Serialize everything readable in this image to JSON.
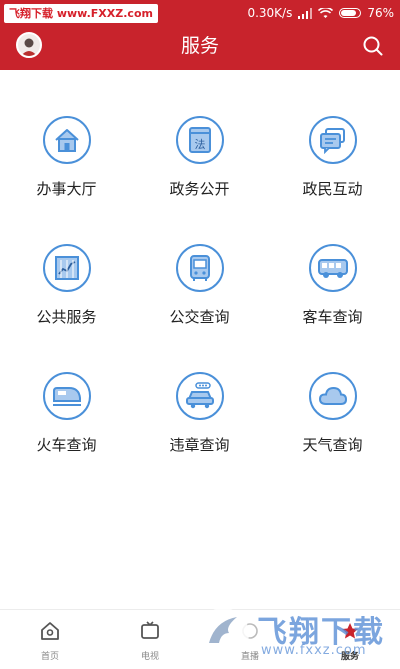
{
  "status_bar": {
    "watermark_text": "飞翔下载 www.FXXZ.com",
    "speed": "0.30K/s",
    "battery": "76%"
  },
  "header": {
    "title": "服务",
    "avatar_icon": "user-avatar-icon",
    "search_icon": "search-icon"
  },
  "services": [
    {
      "label": "办事大厅",
      "icon": "house-icon"
    },
    {
      "label": "政务公开",
      "icon": "law-book-icon"
    },
    {
      "label": "政民互动",
      "icon": "chat-bubbles-icon"
    },
    {
      "label": "公共服务",
      "icon": "chart-icon"
    },
    {
      "label": "公交查询",
      "icon": "bus-icon"
    },
    {
      "label": "客车查询",
      "icon": "coach-icon"
    },
    {
      "label": "火车查询",
      "icon": "train-icon"
    },
    {
      "label": "违章查询",
      "icon": "car-violation-icon"
    },
    {
      "label": "天气查询",
      "icon": "cloud-icon"
    }
  ],
  "bottom_nav": [
    {
      "label": "首页",
      "icon": "home-icon"
    },
    {
      "label": "电视",
      "icon": "tv-icon"
    },
    {
      "label": "直播",
      "icon": "live-icon"
    },
    {
      "label": "服务",
      "icon": "service-icon",
      "active": true
    }
  ],
  "watermark": {
    "logo_text": "飞翔下载",
    "url": "www.fxxz.com"
  },
  "colors": {
    "brand_red": "#c8232c",
    "icon_blue": "#4a90d9"
  }
}
